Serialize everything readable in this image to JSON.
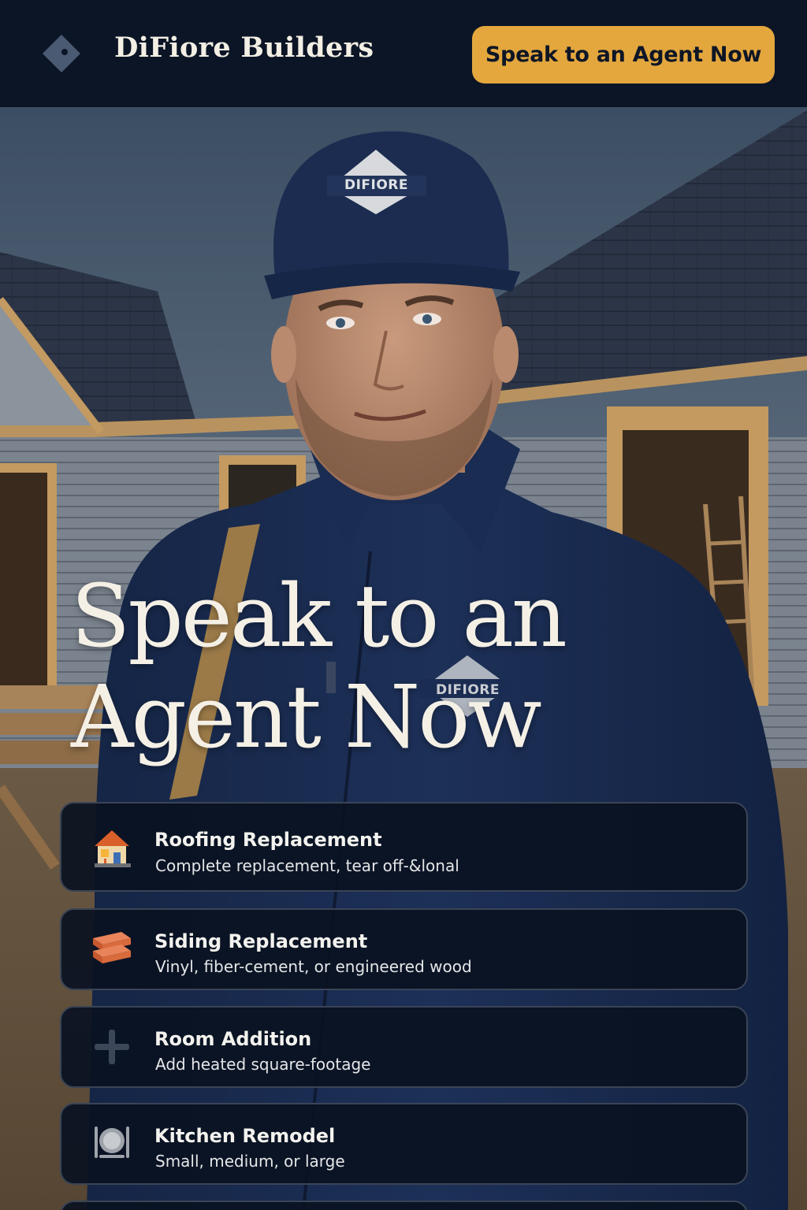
{
  "header": {
    "brand": "DiFiore Builders",
    "cta_label": "Speak to an Agent Now"
  },
  "hero": {
    "headline": "Speak to an Agent Now",
    "cap_logo_text": "DIFIORE",
    "jacket_logo_text": "DIFIORE"
  },
  "services": [
    {
      "title": "Roofing Replacement",
      "description": "Complete replacement, tear off-&lonal",
      "icon": "house-icon"
    },
    {
      "title": "Siding Replacement",
      "description": "Vinyl, fiber-cement, or engineered wood",
      "icon": "siding-panels-icon"
    },
    {
      "title": "Room Addition",
      "description": "Add heated square-footage",
      "icon": "plus-icon"
    },
    {
      "title": "Kitchen Remodel",
      "description": "Small, medium, or large",
      "icon": "plate-utensils-icon"
    }
  ],
  "colors": {
    "header_bg": "#0c1526",
    "accent": "#e3a73e",
    "card_bg": "#0a1221",
    "headline": "#f5f0e6"
  }
}
